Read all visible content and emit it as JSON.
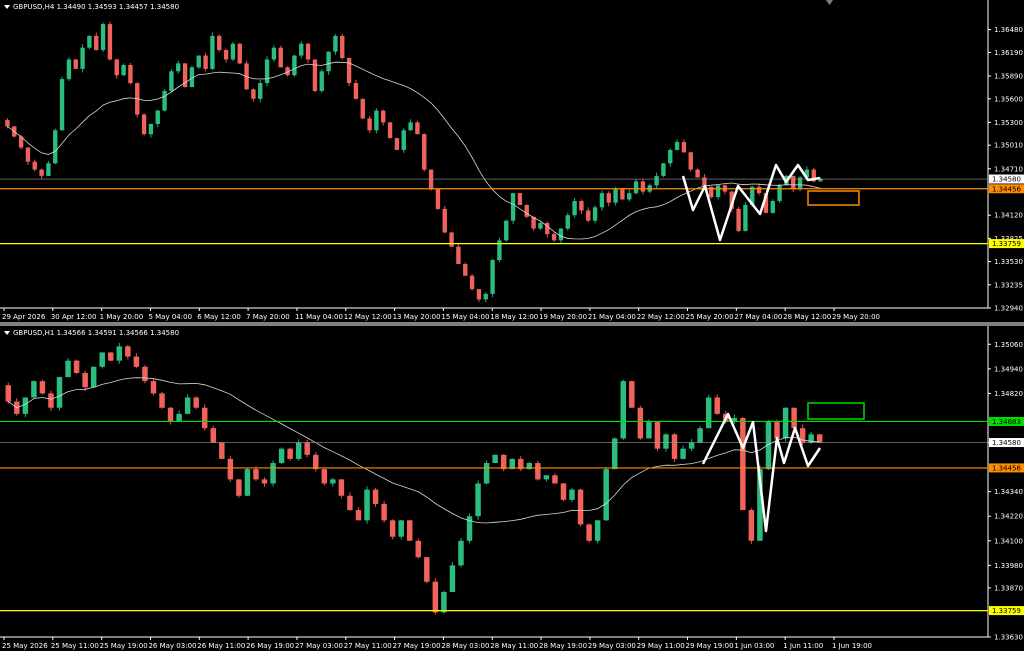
{
  "panes": [
    {
      "id": "pane1",
      "title": "GBPUSD,H4  1.34490 1.34593 1.34457 1.34580",
      "ylim": [
        1.3294,
        1.3678
      ],
      "y_ticks": [
        "1.36480",
        "1.36190",
        "1.35890",
        "1.35600",
        "1.35300",
        "1.35010",
        "1.34710",
        "1.34120",
        "1.33825",
        "1.33530",
        "1.33235",
        "1.32940"
      ],
      "x_labels": [
        "29 Apr 2026",
        "30 Apr 12:00",
        "1 May 20:00",
        "5 May 04:00",
        "6 May 12:00",
        "7 May 20:00",
        "11 May 04:00",
        "12 May 12:00",
        "13 May 20:00",
        "15 May 04:00",
        "18 May 12:00",
        "19 May 20:00",
        "21 May 04:00",
        "22 May 12:00",
        "25 May 20:00",
        "27 May 04:00",
        "28 May 12:00",
        "29 May 20:00"
      ],
      "levels": [
        {
          "label": "1.34580",
          "color": "#ffffff",
          "price": 1.3458
        },
        {
          "label": "1.34456",
          "color": "#ff8c00",
          "price": 1.34456
        },
        {
          "label": "1.33759",
          "color": "#ffff00",
          "price": 1.33759
        }
      ]
    },
    {
      "id": "pane2",
      "title": "GBPUSD,H1  1.34566 1.34591 1.34566 1.34580",
      "ylim": [
        1.3363,
        1.3512
      ],
      "y_ticks": [
        "1.35060",
        "1.34940",
        "1.34820",
        "1.34580",
        "1.34340",
        "1.34220",
        "1.34100",
        "1.33980",
        "1.33870",
        "1.33630"
      ],
      "x_labels": [
        "25 May 2026",
        "25 May 11:00",
        "25 May 19:00",
        "26 May 03:00",
        "26 May 11:00",
        "26 May 19:00",
        "27 May 03:00",
        "27 May 11:00",
        "27 May 19:00",
        "28 May 03:00",
        "28 May 11:00",
        "28 May 19:00",
        "29 May 03:00",
        "29 May 11:00",
        "29 May 19:00",
        "1 Jun 03:00",
        "1 Jun 11:00",
        "1 Jun 19:00"
      ],
      "levels": [
        {
          "label": "1.34683",
          "color": "#00dd00",
          "price": 1.34683
        },
        {
          "label": "1.34580",
          "color": "#ffffff",
          "price": 1.3458
        },
        {
          "label": "1.34456",
          "color": "#ff8c00",
          "price": 1.34456
        },
        {
          "label": "1.33759",
          "color": "#ffff00",
          "price": 1.33759
        }
      ]
    }
  ],
  "chart_data": [
    {
      "type": "candlestick",
      "symbol": "GBPUSD",
      "timeframe": "H4",
      "ylim": [
        1.3294,
        1.3678
      ],
      "closes": [
        1.3525,
        1.3512,
        1.3498,
        1.348,
        1.347,
        1.3462,
        1.3478,
        1.352,
        1.3585,
        1.361,
        1.3598,
        1.3625,
        1.364,
        1.3622,
        1.3655,
        1.361,
        1.359,
        1.3603,
        1.358,
        1.354,
        1.3515,
        1.3528,
        1.3545,
        1.357,
        1.3595,
        1.3605,
        1.3575,
        1.36,
        1.3615,
        1.3598,
        1.364,
        1.3622,
        1.361,
        1.363,
        1.3605,
        1.3572,
        1.356,
        1.358,
        1.361,
        1.3625,
        1.36,
        1.359,
        1.3615,
        1.363,
        1.361,
        1.357,
        1.3595,
        1.362,
        1.364,
        1.3612,
        1.358,
        1.356,
        1.3535,
        1.352,
        1.3545,
        1.353,
        1.351,
        1.3495,
        1.352,
        1.353,
        1.3515,
        1.347,
        1.3445,
        1.342,
        1.339,
        1.3372,
        1.335,
        1.3335,
        1.3318,
        1.3305,
        1.3312,
        1.3355,
        1.338,
        1.3405,
        1.344,
        1.3425,
        1.341,
        1.3395,
        1.3402,
        1.3388,
        1.338,
        1.3395,
        1.3412,
        1.343,
        1.3418,
        1.3405,
        1.3422,
        1.344,
        1.3428,
        1.3445,
        1.3432,
        1.344,
        1.3455,
        1.3442,
        1.345,
        1.3462,
        1.3478,
        1.3495,
        1.3505,
        1.3492,
        1.347,
        1.346,
        1.3448,
        1.3435,
        1.345,
        1.3442,
        1.342,
        1.3392,
        1.3425,
        1.3448,
        1.344,
        1.3415,
        1.343,
        1.345,
        1.3462,
        1.3445,
        1.346,
        1.347,
        1.3455,
        1.3458
      ],
      "ma_period": 21,
      "levels": [
        1.3458,
        1.34456,
        1.33759
      ]
    },
    {
      "type": "candlestick",
      "symbol": "GBPUSD",
      "timeframe": "H1",
      "ylim": [
        1.3363,
        1.3512
      ],
      "closes": [
        1.3478,
        1.3472,
        1.348,
        1.3488,
        1.3482,
        1.3475,
        1.349,
        1.3498,
        1.3492,
        1.3485,
        1.3495,
        1.3502,
        1.3498,
        1.3505,
        1.35,
        1.3495,
        1.3488,
        1.3482,
        1.3475,
        1.3468,
        1.3472,
        1.348,
        1.3475,
        1.3465,
        1.3458,
        1.345,
        1.344,
        1.3432,
        1.3445,
        1.344,
        1.3438,
        1.3448,
        1.3455,
        1.345,
        1.3458,
        1.3452,
        1.3445,
        1.3438,
        1.344,
        1.3432,
        1.3425,
        1.342,
        1.3435,
        1.3428,
        1.342,
        1.3412,
        1.342,
        1.341,
        1.3402,
        1.339,
        1.3375,
        1.3385,
        1.3398,
        1.341,
        1.3422,
        1.3438,
        1.3448,
        1.3452,
        1.3445,
        1.345,
        1.3445,
        1.3448,
        1.344,
        1.3442,
        1.3438,
        1.343,
        1.3435,
        1.3418,
        1.341,
        1.342,
        1.3445,
        1.346,
        1.3488,
        1.3475,
        1.346,
        1.3468,
        1.3455,
        1.3462,
        1.345,
        1.3455,
        1.3458,
        1.3465,
        1.348,
        1.3472,
        1.3468,
        1.347,
        1.3425,
        1.341,
        1.3445,
        1.3468,
        1.346,
        1.3475,
        1.3465,
        1.3458,
        1.3462,
        1.3458
      ],
      "ma_period": 21,
      "levels": [
        1.34683,
        1.3458,
        1.34456,
        1.33759
      ]
    }
  ]
}
